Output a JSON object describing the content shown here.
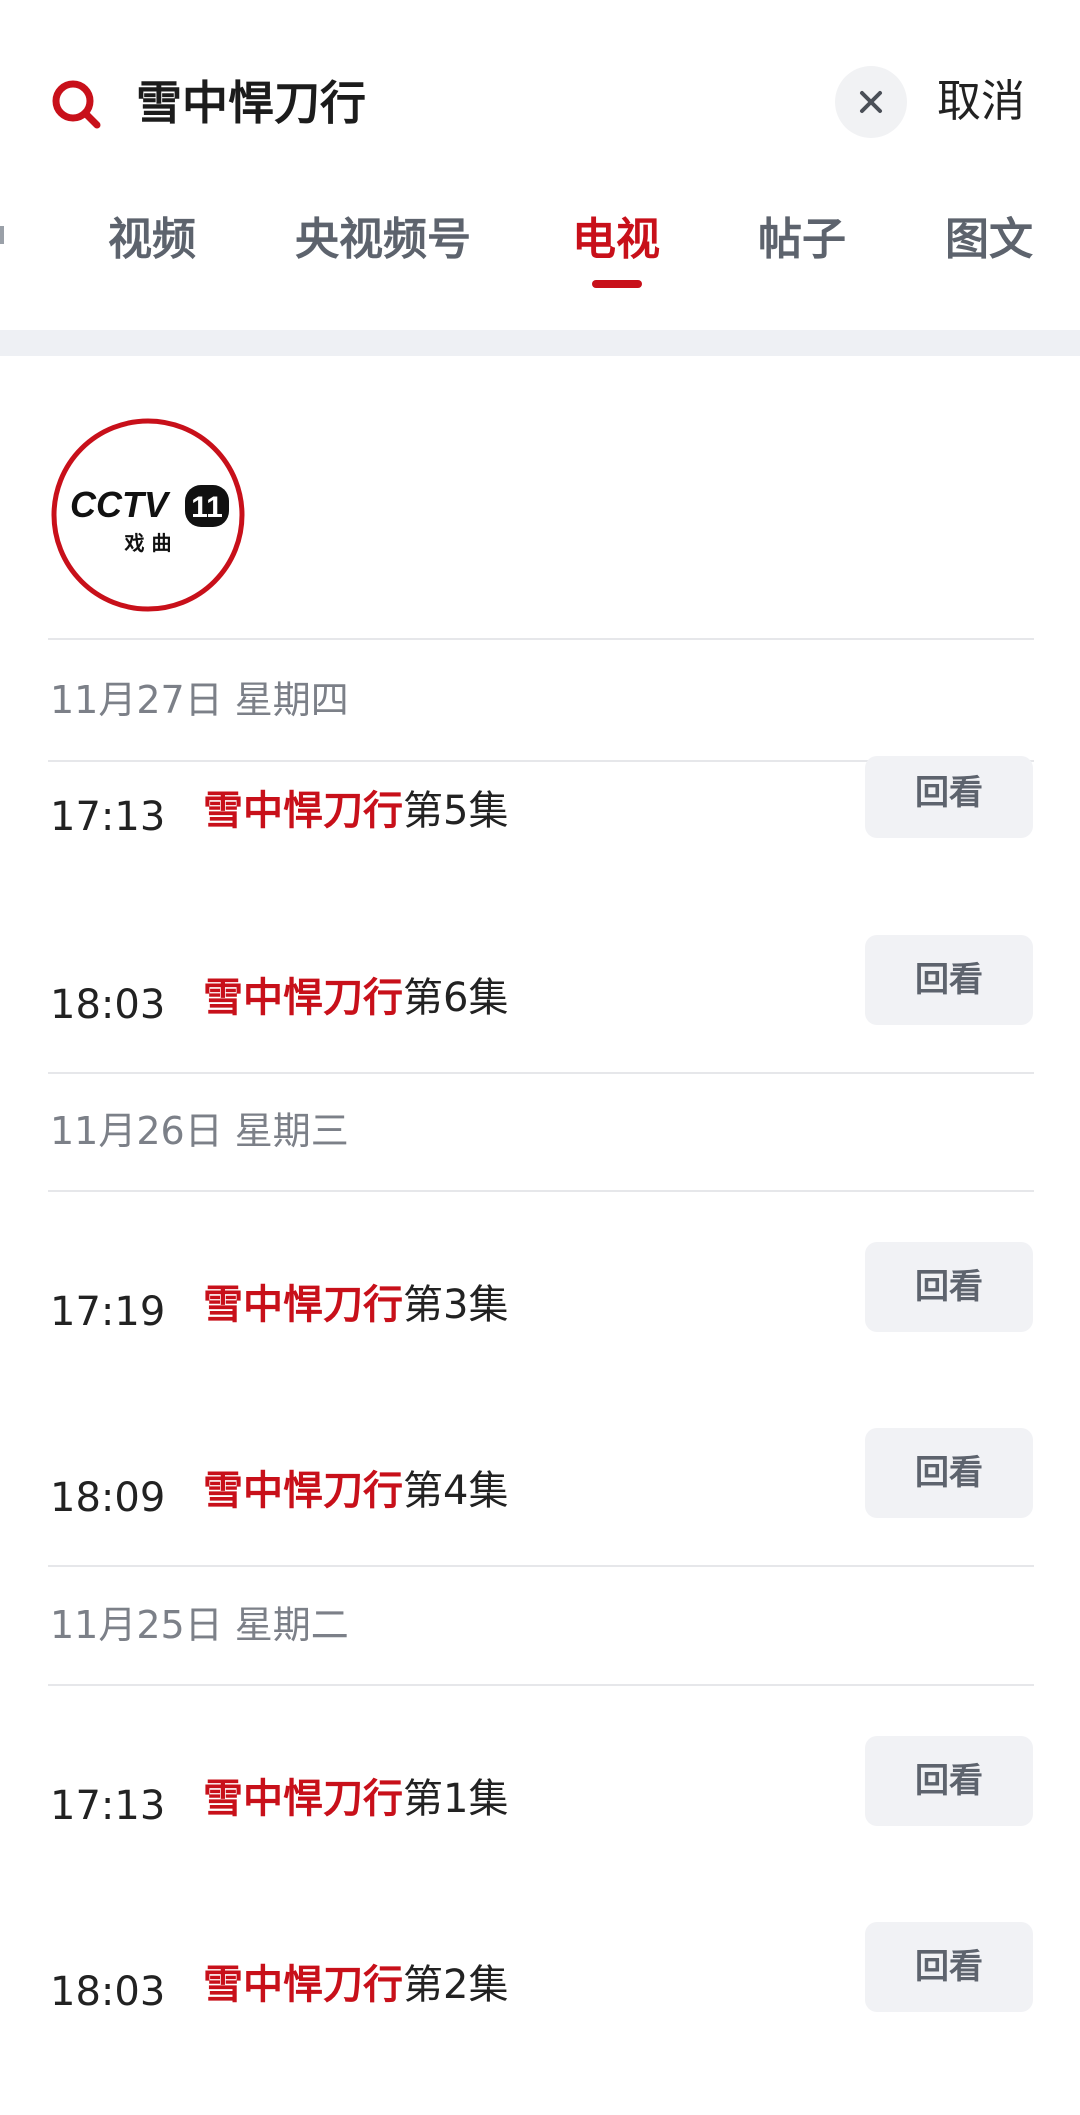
{
  "search": {
    "query": "雪中悍刀行",
    "cancel_label": "取消"
  },
  "tabs": [
    {
      "label": "视频"
    },
    {
      "label": "央视频号"
    },
    {
      "label": "电视"
    },
    {
      "label": "帖子"
    },
    {
      "label": "图文"
    }
  ],
  "active_tab": "电视",
  "accent_color": "#c8101a",
  "channel": {
    "logo_text": "CCTV",
    "logo_number": "11",
    "logo_subtitle": "戏 曲"
  },
  "schedule": [
    {
      "date": "11月27日 星期四",
      "episodes": [
        {
          "time": "17:13",
          "title": "雪中悍刀行",
          "episode": "第5集",
          "action": "回看"
        },
        {
          "time": "18:03",
          "title": "雪中悍刀行",
          "episode": "第6集",
          "action": "回看"
        }
      ]
    },
    {
      "date": "11月26日 星期三",
      "episodes": [
        {
          "time": "17:19",
          "title": "雪中悍刀行",
          "episode": "第3集",
          "action": "回看"
        },
        {
          "time": "18:09",
          "title": "雪中悍刀行",
          "episode": "第4集",
          "action": "回看"
        }
      ]
    },
    {
      "date": "11月25日 星期二",
      "episodes": [
        {
          "time": "17:13",
          "title": "雪中悍刀行",
          "episode": "第1集",
          "action": "回看"
        },
        {
          "time": "18:03",
          "title": "雪中悍刀行",
          "episode": "第2集",
          "action": "回看"
        }
      ]
    }
  ]
}
